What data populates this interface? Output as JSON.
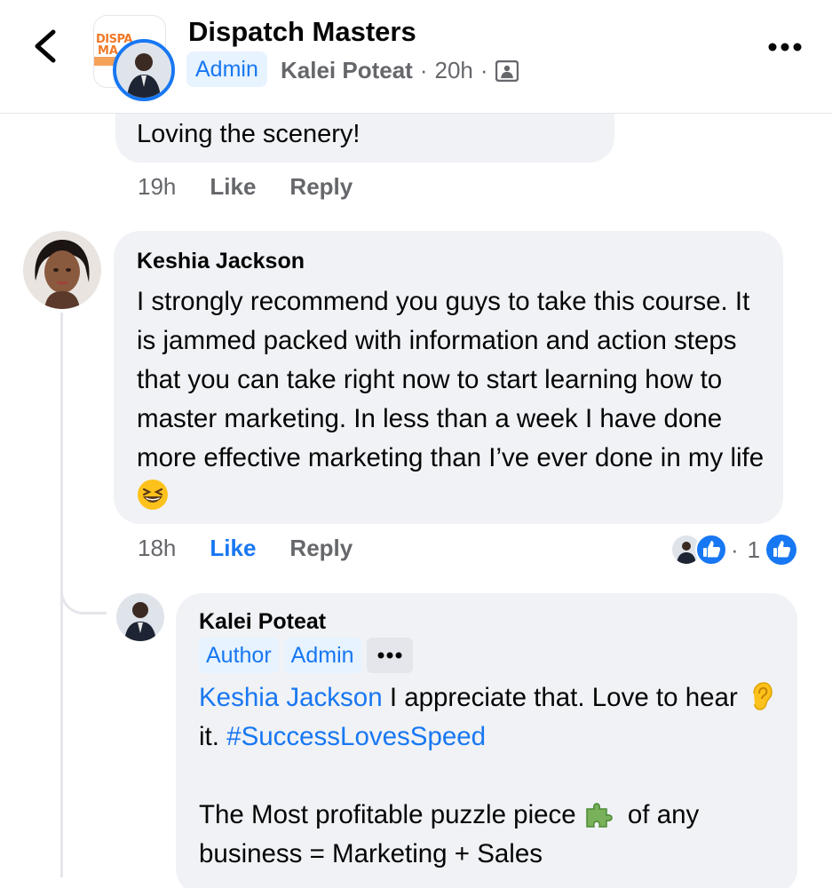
{
  "header": {
    "title": "Dispatch Masters",
    "admin_badge": "Admin",
    "post_author": "Kalei Poteat",
    "post_time": "20h",
    "separator": "·",
    "logo_line1": "DISPA",
    "logo_line2": "MA"
  },
  "prev_comment": {
    "text": "Loving the scenery!",
    "time": "19h",
    "like_label": "Like",
    "reply_label": "Reply"
  },
  "comment": {
    "author": "Keshia Jackson",
    "text": "I strongly recommend you guys to take this course. It is jammed packed with information and action steps that you can take right now to start learning how to master marketing. In less than a week I have done more effective marketing than I’ve ever done in my life",
    "time": "18h",
    "like_label": "Like",
    "reply_label": "Reply",
    "reaction_separator": "·",
    "reaction_count": "1"
  },
  "reply": {
    "author": "Kalei Poteat",
    "badge_author": "Author",
    "badge_admin": "Admin",
    "mention": "Keshia Jackson",
    "text1": " I appreciate that. Love to hear",
    "text2": " it. ",
    "hashtag": "#SuccessLovesSpeed",
    "text3": "The Most profitable puzzle piece",
    "text4": " of any business = Marketing + Sales"
  },
  "colors": {
    "accent": "#1877f2",
    "bubble": "#f0f2f5",
    "muted": "#65676b",
    "badge_bg": "#e7f3ff"
  },
  "icons": [
    "back-arrow-icon",
    "more-icon",
    "photo-icon",
    "like-icon",
    "grinning-squinting-emoji",
    "ear-emoji",
    "puzzle-emoji"
  ]
}
